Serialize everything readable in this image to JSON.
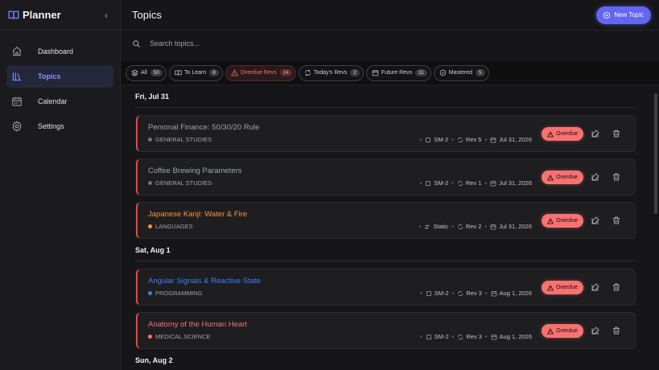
{
  "app": {
    "name": "Planner"
  },
  "sidebar": {
    "items": [
      {
        "label": "Dashboard",
        "icon": "home-icon"
      },
      {
        "label": "Topics",
        "icon": "library-icon"
      },
      {
        "label": "Calendar",
        "icon": "calendar-icon"
      },
      {
        "label": "Settings",
        "icon": "gear-icon"
      }
    ]
  },
  "header": {
    "title": "Topics",
    "new_topic_label": "New Topic"
  },
  "search": {
    "placeholder": "Search topics..."
  },
  "filters": [
    {
      "label": "All",
      "count": "50",
      "icon": "layers-icon"
    },
    {
      "label": "To Learn",
      "count": "8",
      "icon": "book-icon"
    },
    {
      "label": "Overdue Revs",
      "count": "24",
      "icon": "warning-icon"
    },
    {
      "label": "Today's Revs",
      "count": "2",
      "icon": "refresh-icon"
    },
    {
      "label": "Future Revs",
      "count": "11",
      "icon": "calendar-icon"
    },
    {
      "label": "Mastered",
      "count": "5",
      "icon": "check-circle-icon"
    }
  ],
  "groups": [
    {
      "date": "Fri, Jul 31",
      "topics": [
        {
          "title": "Personal Finance: 50/30/20 Rule",
          "category": "GENERAL STUDIES",
          "algorithm": "SM-2",
          "revision": "Rev 5",
          "due": "Jul 31, 2026",
          "status": "Overdue"
        },
        {
          "title": "Coffee Brewing Parameters",
          "category": "GENERAL STUDIES",
          "algorithm": "SM-2",
          "revision": "Rev 1",
          "due": "Jul 31, 2026",
          "status": "Overdue"
        },
        {
          "title": "Japanese Kanji: Water & Fire",
          "category": "LANGUAGES",
          "algorithm": "Static",
          "revision": "Rev 2",
          "due": "Jul 31, 2026",
          "status": "Overdue"
        }
      ]
    },
    {
      "date": "Sat, Aug 1",
      "topics": [
        {
          "title": "Angular Signals & Reactive State",
          "category": "PROGRAMMING",
          "algorithm": "SM-2",
          "revision": "Rev 3",
          "due": "Aug 1, 2026",
          "status": "Overdue"
        },
        {
          "title": "Anatomy of the Human Heart",
          "category": "MEDICAL SCIENCE",
          "algorithm": "SM-2",
          "revision": "Rev 3",
          "due": "Aug 1, 2026",
          "status": "Overdue"
        }
      ]
    },
    {
      "date": "Sun, Aug 2",
      "topics": []
    }
  ],
  "colors": {
    "accent": "#6366f1",
    "overdue": "#f87171",
    "general_studies": "#9ca3af",
    "languages": "#fb923c",
    "programming": "#3b82f6",
    "medical_science": "#f87171"
  }
}
